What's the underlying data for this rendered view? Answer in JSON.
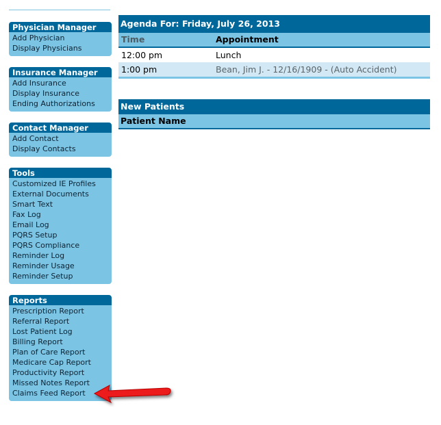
{
  "sidebar": {
    "sections": [
      {
        "title": "Physician Manager",
        "items": [
          "Add Physician",
          "Display Physicians"
        ]
      },
      {
        "title": "Insurance Manager",
        "items": [
          "Add Insurance",
          "Display Insurance",
          "Ending Authorizations"
        ]
      },
      {
        "title": "Contact Manager",
        "items": [
          "Add Contact",
          "Display Contacts"
        ]
      },
      {
        "title": "Tools",
        "items": [
          "Customized IE Profiles",
          "External Documents",
          "Smart Text",
          "Fax Log",
          "Email Log",
          "PQRS Setup",
          "PQRS Compliance",
          "Reminder Log",
          "Reminder Usage",
          "Reminder Setup"
        ]
      },
      {
        "title": "Reports",
        "items": [
          "Prescription Report",
          "Referral Report",
          "Lost Patient Log",
          "Billing Report",
          "Plan of Care Report",
          "Medicare Cap Report",
          "Productivity Report",
          "Missed Notes Report",
          "Claims Feed Report"
        ]
      }
    ]
  },
  "agenda": {
    "title": "Agenda For: Friday, July 26, 2013",
    "columns": {
      "time": "Time",
      "appointment": "Appointment"
    },
    "rows": [
      {
        "time": "12:00 pm",
        "appointment": "Lunch"
      },
      {
        "time": "1:00 pm",
        "appointment": "Bean, Jim J. - 12/16/1909 - (Auto Accident)"
      }
    ]
  },
  "new_patients": {
    "title": "New Patients",
    "columns": {
      "name": "Patient Name"
    }
  },
  "annotation": {
    "icon": "red-arrow-icon",
    "points_to": "Missed Notes Report",
    "color": "#e01010"
  },
  "colors": {
    "header": "#00679a",
    "light": "#7cc4e4",
    "row_alt": "#d2e9f5"
  }
}
